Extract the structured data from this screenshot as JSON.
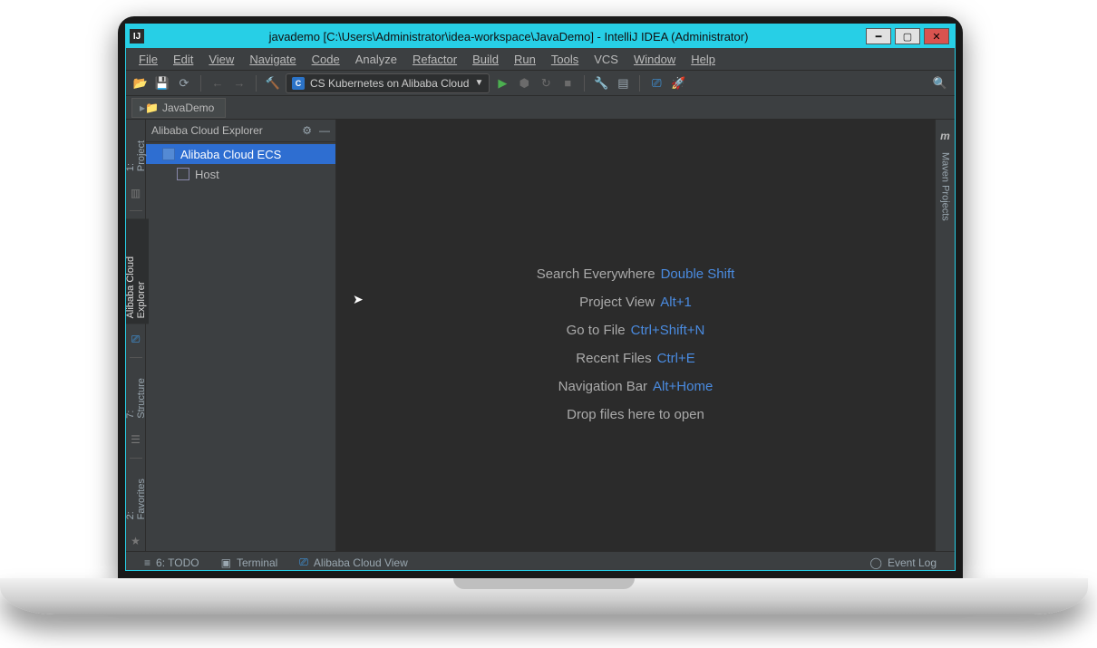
{
  "titlebar": {
    "title": "javademo [C:\\Users\\Administrator\\idea-workspace\\JavaDemo] - IntelliJ IDEA (Administrator)",
    "app_icon": "IJ"
  },
  "menu": [
    "File",
    "Edit",
    "View",
    "Navigate",
    "Code",
    "Analyze",
    "Refactor",
    "Build",
    "Run",
    "Tools",
    "VCS",
    "Window",
    "Help"
  ],
  "toolbar": {
    "run_config_label": "CS Kubernetes on Alibaba Cloud"
  },
  "breadcrumb": {
    "project": "JavaDemo"
  },
  "left_gutter": {
    "project_tab": "1: Project",
    "explorer_tab": "Alibaba Cloud Explorer",
    "structure_tab": "7: Structure",
    "favorites_tab": "2: Favorites"
  },
  "right_gutter": {
    "maven_tab": "Maven Projects",
    "maven_icon": "m"
  },
  "panel": {
    "title": "Alibaba Cloud Explorer",
    "nodes": [
      {
        "label": "Alibaba Cloud ECS",
        "selected": true,
        "icon": "cloud"
      },
      {
        "label": "Host",
        "selected": false,
        "icon": "host"
      }
    ]
  },
  "hints": [
    {
      "label": "Search Everywhere",
      "key": "Double Shift"
    },
    {
      "label": "Project View",
      "key": "Alt+1"
    },
    {
      "label": "Go to File",
      "key": "Ctrl+Shift+N"
    },
    {
      "label": "Recent Files",
      "key": "Ctrl+E"
    },
    {
      "label": "Navigation Bar",
      "key": "Alt+Home"
    },
    {
      "label": "Drop files here to open",
      "key": ""
    }
  ],
  "bottom": {
    "todo": "6: TODO",
    "terminal": "Terminal",
    "cloudview": "Alibaba Cloud View",
    "eventlog": "Event Log"
  }
}
